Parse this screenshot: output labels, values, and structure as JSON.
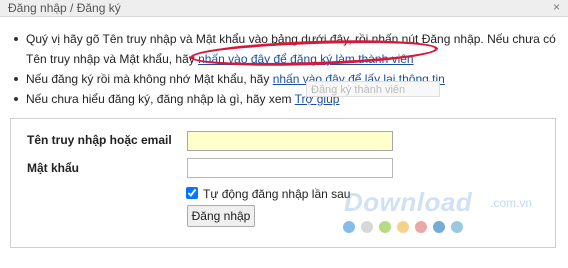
{
  "window": {
    "title": "Đăng nhập / Đăng ký",
    "close_symbol": "×"
  },
  "bullets": {
    "b1_line1": "Quý vị hãy gõ Tên truy nhập và Mật khẩu vào bảng dưới đây, rồi nhấn nút Đăng nhập. Nếu chưa có",
    "b1_line2_prefix": "Tên truy nhập và Mật khẩu, hãy ",
    "b1_link": "nhấn vào đây để đăng ký làm thành viên",
    "b2_prefix": "Nếu đăng ký rồi mà không nhớ Mật khẩu, hãy ",
    "b2_link": "nhấn vào đây để lấy lại thông tin",
    "b3_prefix": "Nếu chưa hiểu đăng ký, đăng nhập là gì, hãy xem ",
    "b3_link": "Trợ giúp"
  },
  "tooltip": {
    "text": "Đăng ký thành viên"
  },
  "form": {
    "username_label": "Tên truy nhập hoặc email",
    "username_value": "",
    "password_label": "Mật khẩu",
    "password_value": "",
    "remember_label": "Tự động đăng nhập lần sau",
    "remember_checked": true,
    "submit_label": "Đăng nhập"
  },
  "watermark": {
    "text": "Download",
    "suffix": ".com.vn",
    "dot_colors": [
      "#5aa7e0",
      "#c9c9c9",
      "#9ccf5a",
      "#f2c46a",
      "#e58a8a",
      "#4a8fc9",
      "#7bb4d9"
    ]
  },
  "colors": {
    "link": "#1a4fa3",
    "highlight_ellipse": "#d6183a",
    "username_bg": "#ffffcc"
  }
}
